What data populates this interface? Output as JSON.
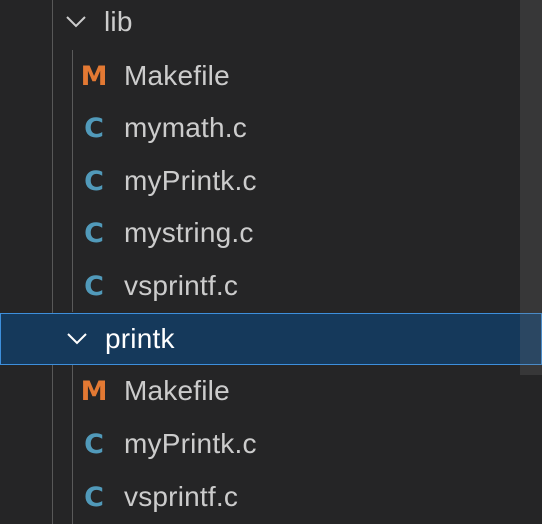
{
  "explorer": {
    "folders": [
      {
        "label": "lib",
        "icon": "chevron-down-icon",
        "files": [
          {
            "label": "Makefile",
            "icon_glyph": "M",
            "icon": "makefile-icon",
            "icon_color": "#e37933"
          },
          {
            "label": "mymath.c",
            "icon_glyph": "C",
            "icon": "c-file-icon",
            "icon_color": "#519aba"
          },
          {
            "label": "myPrintk.c",
            "icon_glyph": "C",
            "icon": "c-file-icon",
            "icon_color": "#519aba"
          },
          {
            "label": "mystring.c",
            "icon_glyph": "C",
            "icon": "c-file-icon",
            "icon_color": "#519aba"
          },
          {
            "label": "vsprintf.c",
            "icon_glyph": "C",
            "icon": "c-file-icon",
            "icon_color": "#519aba"
          }
        ]
      },
      {
        "label": "printk",
        "icon": "chevron-down-icon",
        "selected": true,
        "files": [
          {
            "label": "Makefile",
            "icon_glyph": "M",
            "icon": "makefile-icon",
            "icon_color": "#e37933"
          },
          {
            "label": "myPrintk.c",
            "icon_glyph": "C",
            "icon": "c-file-icon",
            "icon_color": "#519aba"
          },
          {
            "label": "vsprintf.c",
            "icon_glyph": "C",
            "icon": "c-file-icon",
            "icon_color": "#519aba"
          }
        ]
      }
    ],
    "colors": {
      "background": "#252526",
      "selection_bg": "#15395b",
      "selection_border": "#3d8fdc",
      "text": "#cccccc"
    }
  }
}
